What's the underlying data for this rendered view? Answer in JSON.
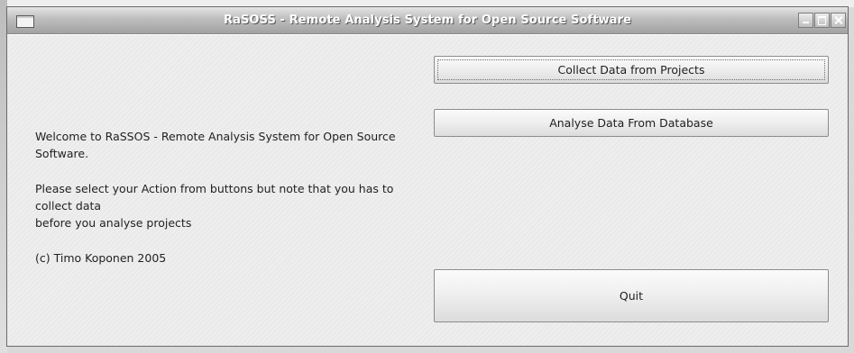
{
  "window": {
    "title": "RaSOSS - Remote Analysis System for Open Source Software"
  },
  "main": {
    "welcome_line": "Welcome to RaSSOS - Remote Analysis System for Open Source Software.",
    "instruction_line1": "Please select your Action from buttons but note that you has to collect data",
    "instruction_line2": "before you analyse projects",
    "copyright": "(c) Timo Koponen 2005"
  },
  "buttons": {
    "collect": "Collect Data from Projects",
    "analyse": "Analyse Data From Database",
    "quit": "Quit"
  }
}
